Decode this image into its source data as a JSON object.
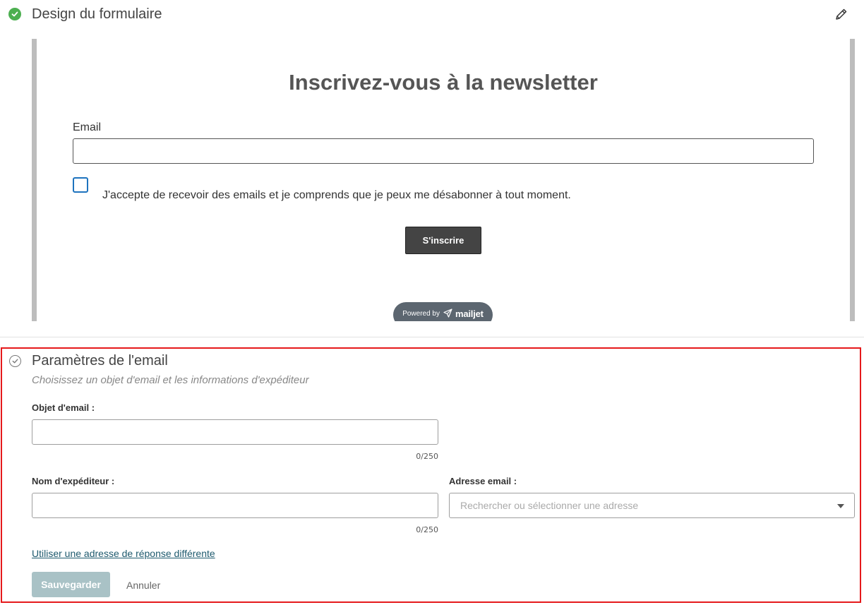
{
  "design": {
    "title": "Design du formulaire",
    "status_icon": "check-circle-icon",
    "edit_icon": "pencil-icon",
    "preview": {
      "heading": "Inscrivez-vous à la newsletter",
      "email_label": "Email",
      "consent_text": "J'accepte de recevoir des emails et je comprends que je peux me désabonner à tout moment.",
      "submit_label": "S'inscrire",
      "powered_by": "Powered by",
      "brand": "mailjet"
    }
  },
  "email_settings": {
    "title": "Paramètres de l'email",
    "subtitle": "Choisissez un objet d'email et les informations d'expéditeur",
    "subject": {
      "label": "Objet d'email :",
      "value": "",
      "counter": "0/250"
    },
    "sender_name": {
      "label": "Nom d'expéditeur :",
      "value": "",
      "counter": "0/250"
    },
    "sender_address": {
      "label": "Adresse email :",
      "placeholder": "Rechercher ou sélectionner une adresse"
    },
    "reply_link": "Utiliser une adresse de réponse différente",
    "save_label": "Sauvegarder",
    "cancel_label": "Annuler"
  },
  "colors": {
    "success": "#4caf50",
    "highlight_border": "#e5191b",
    "save_button": "#a9c2c6",
    "link": "#1e5a6e"
  }
}
